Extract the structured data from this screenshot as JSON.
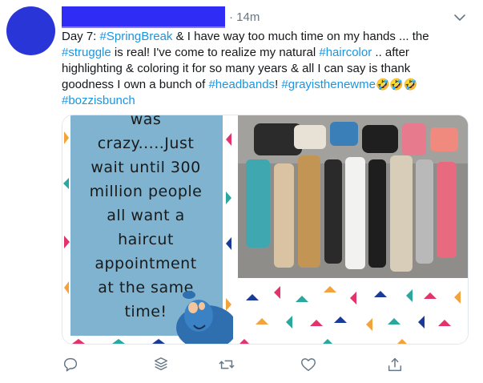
{
  "tweet": {
    "timestamp": "· 14m",
    "text_parts": [
      {
        "text": "Day 7: ",
        "tag": false
      },
      {
        "text": "#SpringBreak",
        "tag": true
      },
      {
        "text": " & I have way too much time on my hands ... the ",
        "tag": false
      },
      {
        "text": "#struggle",
        "tag": true
      },
      {
        "text": " is real! I've come to realize my natural ",
        "tag": false
      },
      {
        "text": "#haircolor",
        "tag": true
      },
      {
        "text": " .. after highlighting & coloring it for so many years & all I can say is thank goodness I own a bunch of ",
        "tag": false
      },
      {
        "text": "#headbands",
        "tag": true
      },
      {
        "text": "! ",
        "tag": false
      },
      {
        "text": "#grayisthenewme",
        "tag": true
      },
      {
        "text": "🤣🤣🤣",
        "tag": false
      },
      {
        "text": " ",
        "tag": false
      },
      {
        "text": "#bozzisbunch",
        "tag": true
      }
    ],
    "media": {
      "sign_lines": [
        "was",
        "crazy.....Just",
        "wait until 300",
        "million people",
        "all want a",
        "haircut",
        "appointment",
        "at the same",
        "time!"
      ]
    }
  },
  "icons": {
    "menu": "chevron-down-icon",
    "reply": "reply-icon",
    "stack": "layers-icon",
    "retweet": "retweet-icon",
    "like": "heart-icon",
    "share": "share-icon"
  },
  "colors": {
    "link": "#1b95e0",
    "avatar": "#2a35d8",
    "name_redaction": "#2f2cf6",
    "icon_gray": "#657786"
  }
}
